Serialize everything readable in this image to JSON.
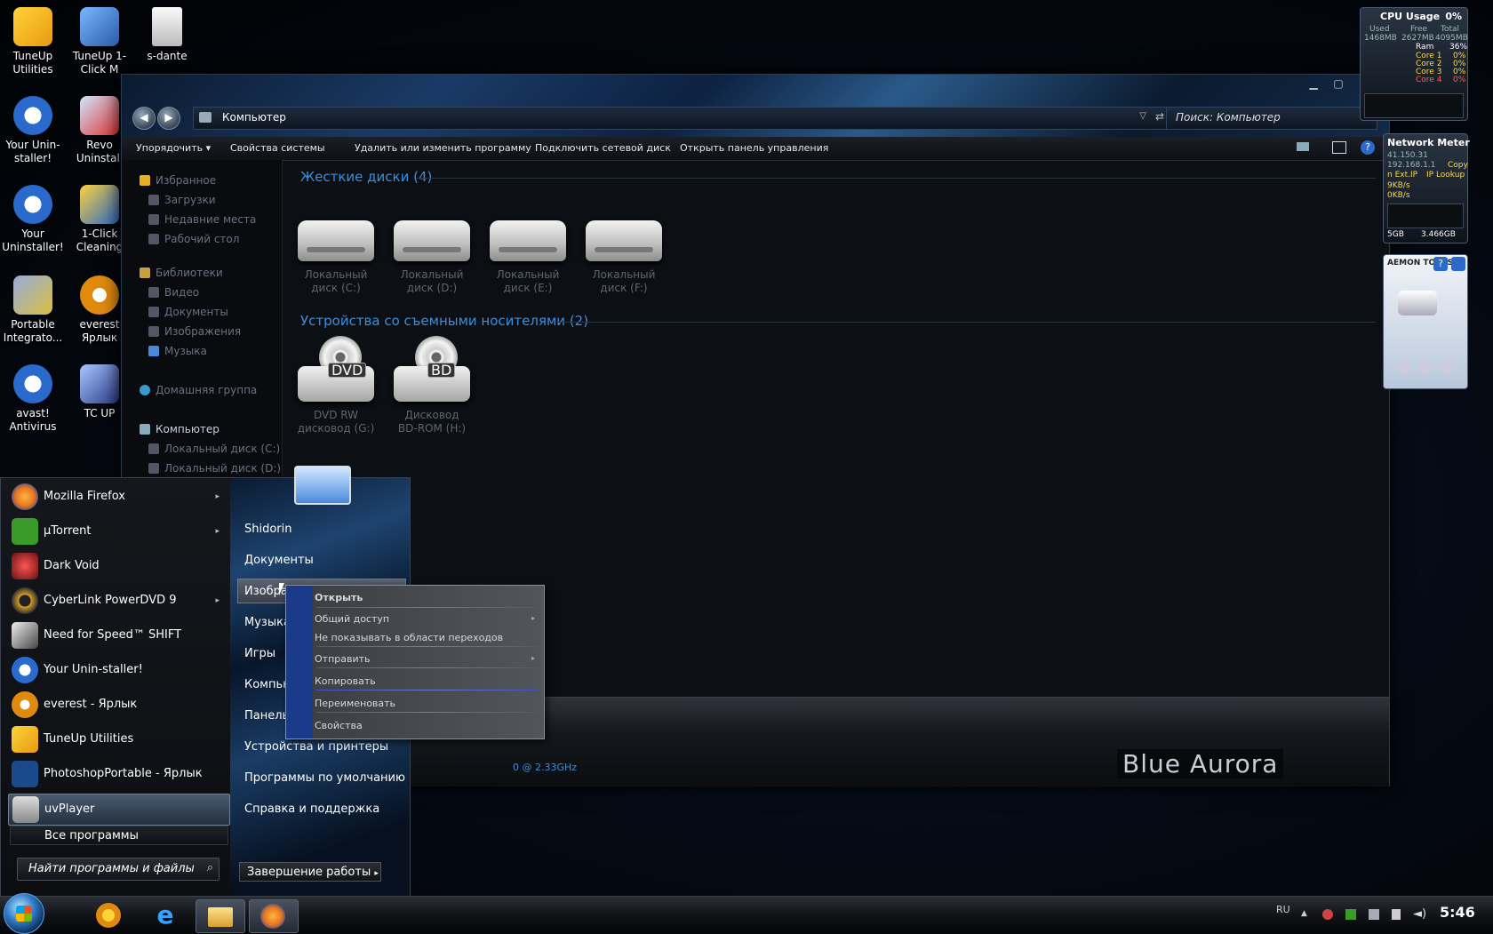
{
  "desktop": {
    "icons": [
      {
        "label": "TuneUp Utilities",
        "icon": "tuneup-icon"
      },
      {
        "label": "TuneUp 1-Click M",
        "icon": "tuneup-1click-icon"
      },
      {
        "label": "s-dante",
        "icon": "disc-image-icon"
      },
      {
        "label": "Your Unin-staller!",
        "icon": "your-uninstaller-icon"
      },
      {
        "label": "Revo Uninstall",
        "icon": "revo-uninstaller-icon"
      },
      {
        "label": "Your Uninstaller!",
        "icon": "your-uninstaller-icon"
      },
      {
        "label": "1-Click Cleaning",
        "icon": "cleaning-icon"
      },
      {
        "label": "Portable Integrato...",
        "icon": "portable-integrator-icon"
      },
      {
        "label": "everest Ярлык",
        "icon": "everest-icon"
      },
      {
        "label": "avast! Antivirus",
        "icon": "avast-icon"
      },
      {
        "label": "TC UP",
        "icon": "tc-up-icon"
      }
    ]
  },
  "explorer": {
    "address": "Компьютер",
    "search_placeholder": "Поиск: Компьютер",
    "toolbar": {
      "organize": "Упорядочить",
      "system_properties": "Свойства системы",
      "uninstall": "Удалить или изменить программу",
      "map_drive": "Подключить сетевой диск",
      "control_panel": "Открыть панель управления"
    },
    "nav": {
      "favorites": "Избранное",
      "downloads": "Загрузки",
      "recent": "Недавние места",
      "desktop": "Рабочий стол",
      "libraries": "Библиотеки",
      "video": "Видео",
      "documents": "Документы",
      "images": "Изображения",
      "music": "Музыка",
      "homegroup": "Домашняя группа",
      "computer": "Компьютер",
      "disk_c": "Локальный диск (C:)",
      "disk_d": "Локальный диск (D:)"
    },
    "hdd_group": "Жесткие диски (4)",
    "removable_group": "Устройства со съемными носителями (2)",
    "drives": [
      {
        "line1": "Локальный",
        "line2": "диск (C:)"
      },
      {
        "line1": "Локальный",
        "line2": "диск (D:)"
      },
      {
        "line1": "Локальный",
        "line2": "диск (E:)"
      },
      {
        "line1": "Локальный",
        "line2": "диск (F:)"
      }
    ],
    "optical": [
      {
        "tag": "DVD",
        "line1": "DVD RW",
        "line2": "дисковод (G:)"
      },
      {
        "tag": "BD",
        "line1": "Дисковод",
        "line2": "BD-ROM (H:)"
      }
    ],
    "details_cpu": "0  @ 2.33GHz",
    "brand": "Blue Aurora"
  },
  "start_menu": {
    "programs": [
      {
        "label": "Mozilla Firefox",
        "icon": "firefox-icon",
        "arrow": "▸",
        "color": "#e8761c"
      },
      {
        "label": "µTorrent",
        "icon": "utorrent-icon",
        "arrow": "▸",
        "color": "#3a9a2a"
      },
      {
        "label": "Dark Void",
        "icon": "dark-void-icon",
        "arrow": "",
        "color": "#a33"
      },
      {
        "label": "CyberLink PowerDVD 9",
        "icon": "powerdvd-icon",
        "arrow": "▸",
        "color": "#d8a020"
      },
      {
        "label": "Need for Speed™ SHIFT",
        "icon": "nfs-shift-icon",
        "arrow": "",
        "color": "#666"
      },
      {
        "label": "Your Unin-staller!",
        "icon": "your-uninstaller-icon",
        "arrow": "",
        "color": "#2a6acc"
      },
      {
        "label": "everest - Ярлык",
        "icon": "everest-icon",
        "arrow": "",
        "color": "#e08a10"
      },
      {
        "label": "TuneUp Utilities",
        "icon": "tuneup-icon",
        "arrow": "",
        "color": "#2a7acc"
      },
      {
        "label": "PhotoshopPortable - Ярлык",
        "icon": "photoshop-icon",
        "arrow": "",
        "color": "#1a4a8a"
      },
      {
        "label": "uvPlayer",
        "icon": "uvplayer-icon",
        "arrow": "",
        "color": "#888"
      }
    ],
    "all_programs": "Все программы",
    "search_placeholder": "Найти программы и файлы",
    "right": {
      "user": "Shidorin",
      "documents": "Документы",
      "images": "Изобра",
      "music": "Музыка",
      "games": "Игры",
      "computer": "Компью",
      "panel": "Панель",
      "devices": "Устройства и принтеры",
      "defaults": "Программы по умолчанию",
      "help": "Справка и поддержка"
    },
    "shutdown": "Завершение работы"
  },
  "context_menu": {
    "open": "Открыть",
    "share": "Общий доступ",
    "hide_nav": "Не показывать в области переходов",
    "send_to": "Отправить",
    "copy": "Копировать",
    "rename": "Переименовать",
    "properties": "Свойства",
    "submenu_arrow": "▸"
  },
  "taskbar": {
    "lang": "RU",
    "clock": "5:46"
  },
  "gadgets": {
    "cpu": {
      "title": "CPU Usage",
      "percent": "0%",
      "used_label": "Used",
      "free_label": "Free",
      "total_label": "Total",
      "used": "1468MB",
      "free": "2627MB",
      "total": "4095MB",
      "ram_label": "Ram",
      "ram": "36%",
      "core1": "Core 1",
      "core2": "Core 2",
      "core3": "Core 3",
      "core4": "Core 4",
      "core_val": "0%"
    },
    "network": {
      "title": "Network Meter",
      "ip1": "41.150.31",
      "ip2": "192.168.1.1",
      "copy": "Copy",
      "ext_ip": "n Ext.IP",
      "ip_lookup": "IP Lookup",
      "down": "9KB/s",
      "up": "0KB/s",
      "total1": "5GB",
      "total2": "3.466GB"
    },
    "daemon": "AEMON TOOLS"
  }
}
